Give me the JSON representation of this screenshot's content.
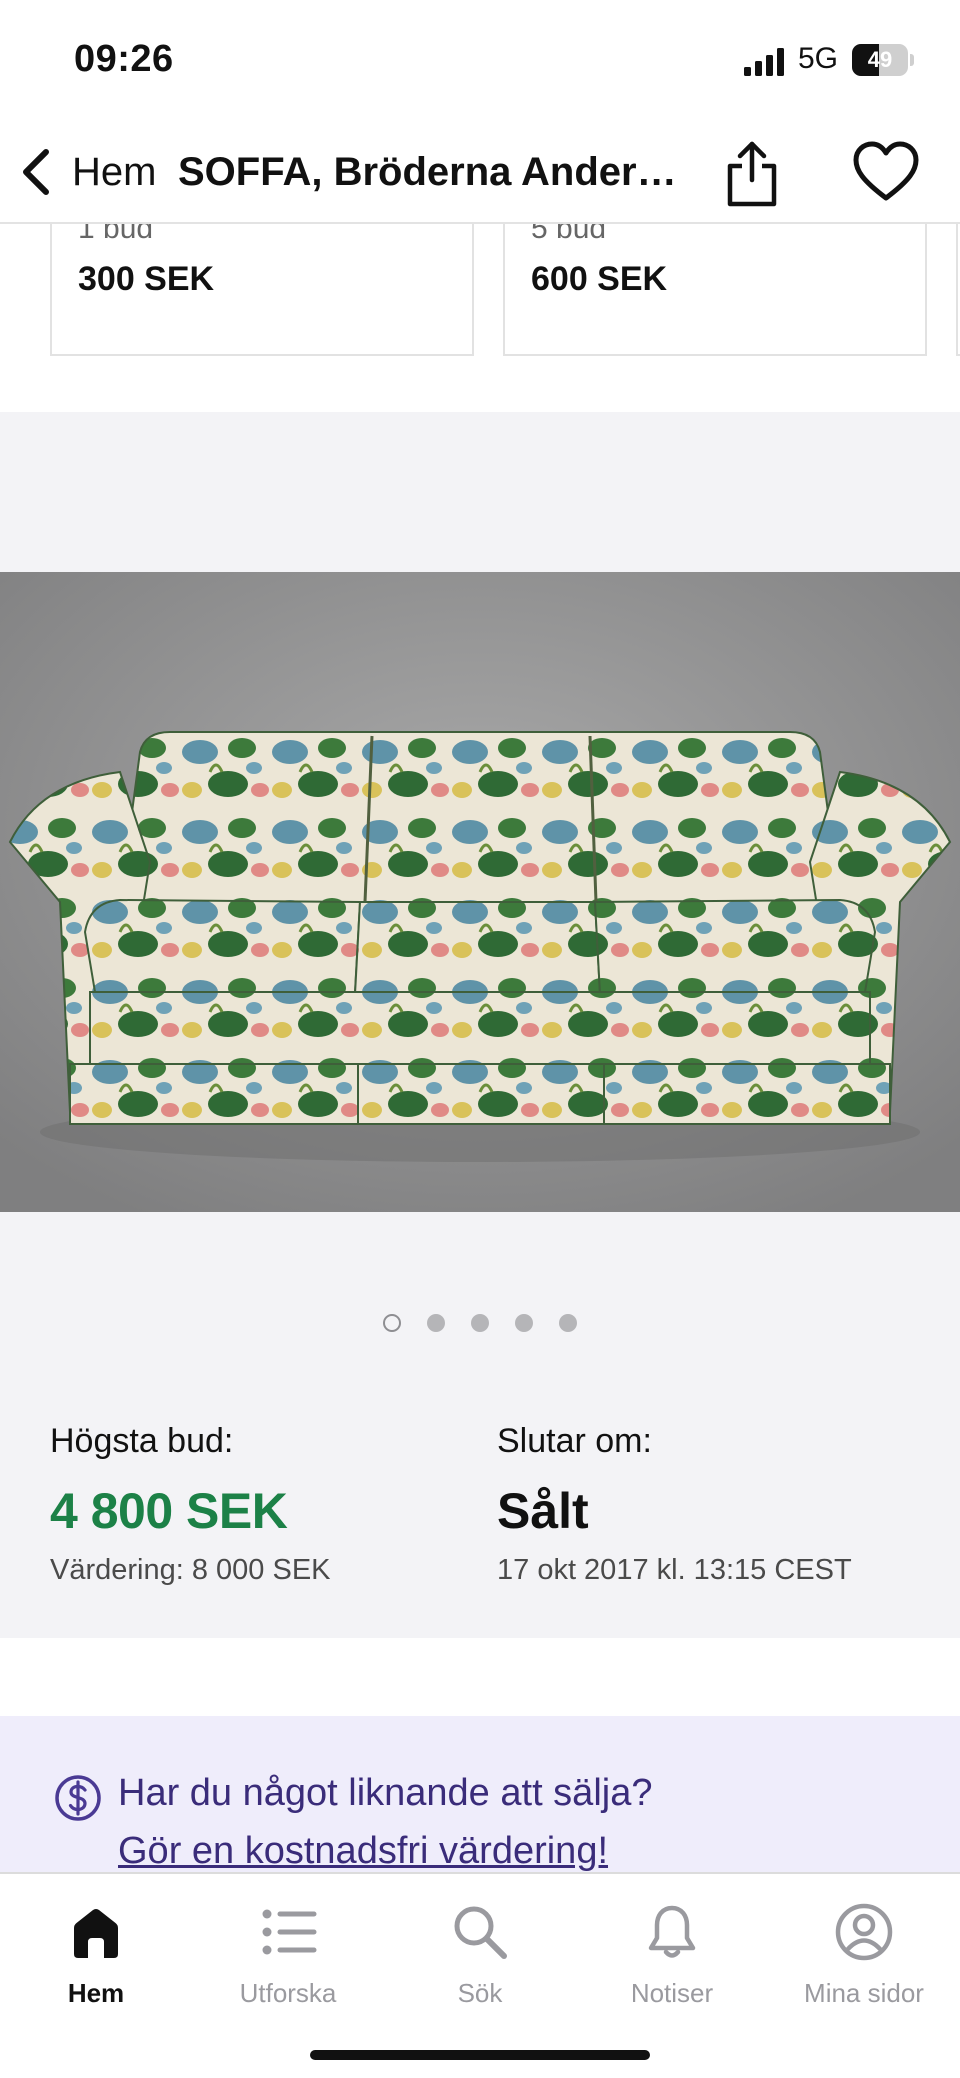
{
  "status": {
    "time": "09:26",
    "network": "5G",
    "battery": "49",
    "battery_level": 0.49
  },
  "nav": {
    "back_label": "Hem",
    "title": "SOFFA, Bröderna Andersson"
  },
  "cards": [
    {
      "bids": "1 bud",
      "price": "300 SEK"
    },
    {
      "bids": "5 bud",
      "price": "600 SEK"
    }
  ],
  "gallery": {
    "image_count": 5,
    "current_index": 0
  },
  "auction": {
    "highest_bid_label": "Högsta bud:",
    "highest_bid": "4 800 SEK",
    "valuation": "Värdering: 8 000 SEK",
    "ends_label": "Slutar om:",
    "ends_value": "Sålt",
    "ends_date": "17 okt 2017 kl. 13:15 CEST"
  },
  "promo": {
    "question": "Har du något liknande att sälja?",
    "link": "Gör en kostnadsfri värdering!",
    "icon": "dollar-circle-icon"
  },
  "tabs": [
    {
      "label": "Hem",
      "icon": "home-icon",
      "active": true
    },
    {
      "label": "Utforska",
      "icon": "list-icon",
      "active": false
    },
    {
      "label": "Sök",
      "icon": "search-icon",
      "active": false
    },
    {
      "label": "Notiser",
      "icon": "bell-icon",
      "active": false
    },
    {
      "label": "Mina sidor",
      "icon": "profile-icon",
      "active": false
    }
  ],
  "colors": {
    "price_green": "#1c8147",
    "promo_bg": "#efedfb",
    "promo_text": "#3a2c7a"
  }
}
